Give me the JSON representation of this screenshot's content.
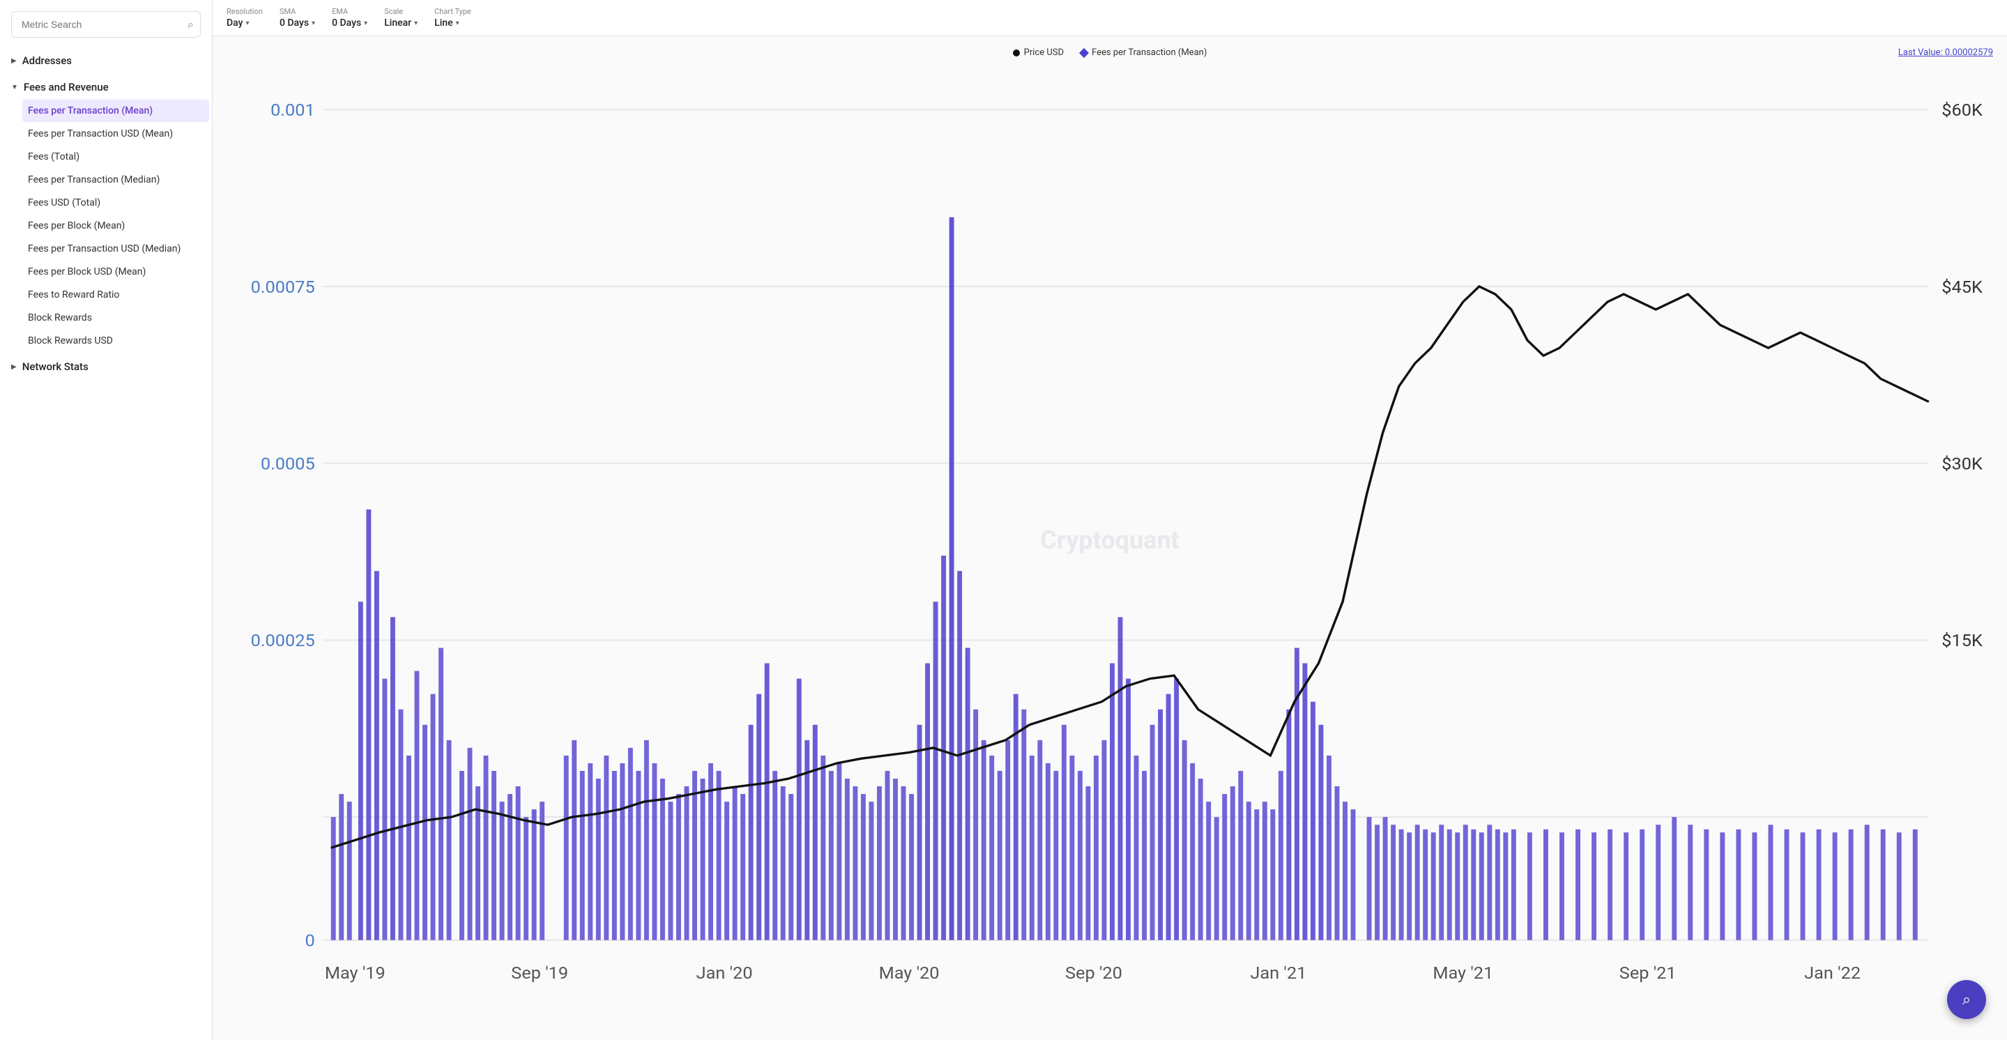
{
  "sidebar": {
    "search": {
      "placeholder": "Metric Search",
      "value": ""
    },
    "sections": [
      {
        "id": "addresses",
        "label": "Addresses",
        "expanded": false,
        "icon": "▶",
        "items": []
      },
      {
        "id": "fees-and-revenue",
        "label": "Fees and Revenue",
        "expanded": true,
        "icon": "▼",
        "items": [
          {
            "id": "fees-per-tx-mean",
            "label": "Fees per Transaction (Mean)",
            "active": true
          },
          {
            "id": "fees-per-tx-usd-mean",
            "label": "Fees per Transaction USD (Mean)",
            "active": false
          },
          {
            "id": "fees-total",
            "label": "Fees (Total)",
            "active": false
          },
          {
            "id": "fees-per-tx-median",
            "label": "Fees per Transaction (Median)",
            "active": false
          },
          {
            "id": "fees-usd-total",
            "label": "Fees USD (Total)",
            "active": false
          },
          {
            "id": "fees-per-block-mean",
            "label": "Fees per Block (Mean)",
            "active": false
          },
          {
            "id": "fees-per-tx-usd-median",
            "label": "Fees per Transaction USD (Median)",
            "active": false
          },
          {
            "id": "fees-per-block-usd-mean",
            "label": "Fees per Block USD (Mean)",
            "active": false
          },
          {
            "id": "fees-to-reward-ratio",
            "label": "Fees to Reward Ratio",
            "active": false
          },
          {
            "id": "block-rewards",
            "label": "Block Rewards",
            "active": false
          },
          {
            "id": "block-rewards-usd",
            "label": "Block Rewards USD",
            "active": false
          }
        ]
      },
      {
        "id": "network-stats",
        "label": "Network Stats",
        "expanded": false,
        "icon": "▶",
        "items": []
      }
    ]
  },
  "toolbar": {
    "resolution": {
      "label": "Resolution",
      "value": "Day"
    },
    "sma": {
      "label": "SMA",
      "value": "0 Days"
    },
    "ema": {
      "label": "EMA",
      "value": "0 Days"
    },
    "scale": {
      "label": "Scale",
      "value": "Linear"
    },
    "chartType": {
      "label": "Chart Type",
      "value": "Line"
    }
  },
  "chart": {
    "legend": {
      "series1": "Price USD",
      "series2": "Fees per Transaction (Mean)",
      "lastValue": "Last Value: 0.00002579"
    },
    "watermark": "Cryptoquant",
    "yAxisLeft": [
      "0.001",
      "0.00075",
      "0.0005",
      "0.00025",
      "0"
    ],
    "yAxisRight": [
      "$60K",
      "$45K",
      "$30K",
      "$15K",
      ""
    ],
    "xAxisLabels": [
      "May '19",
      "Sep '19",
      "Jan '20",
      "May '20",
      "Sep '20",
      "Jan '21",
      "May '21",
      "Sep '21",
      "Jan '22"
    ]
  },
  "fab": {
    "icon": "🔍"
  }
}
